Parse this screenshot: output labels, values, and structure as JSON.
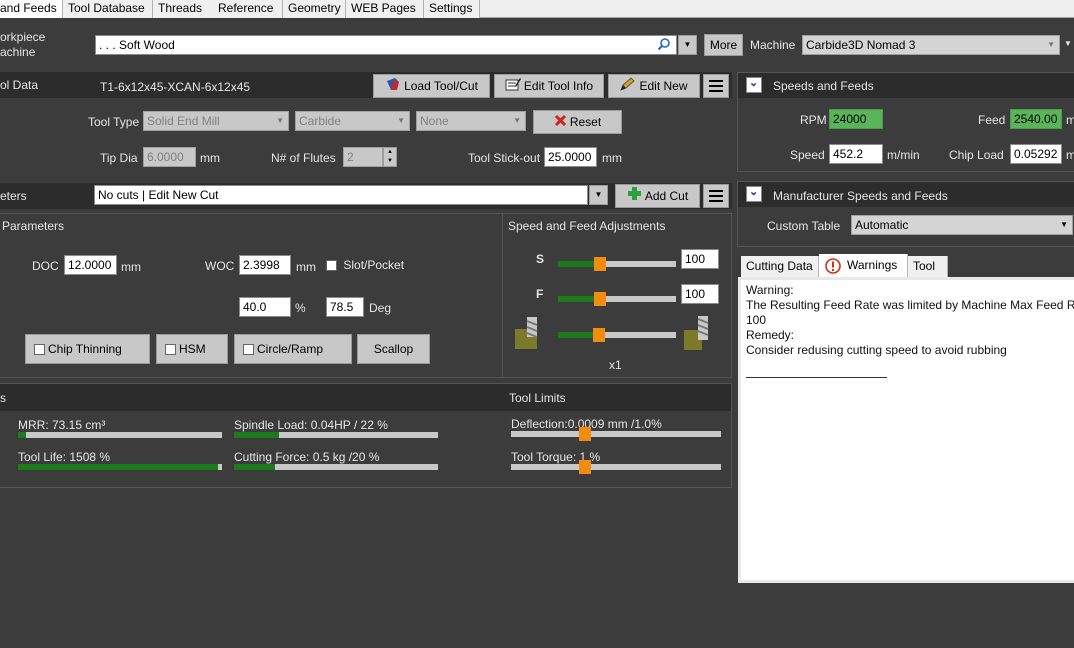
{
  "tabs": [
    "and Feeds",
    "Tool Database",
    "Threads",
    "Reference",
    "Geometry",
    "WEB Pages",
    "Settings"
  ],
  "workpiece": {
    "label1": "orkpiece",
    "label2": "achine",
    "material": ". . . Soft Wood",
    "more_label": "More",
    "machine_label": "Machine",
    "machine_value": "Carbide3D Nomad 3"
  },
  "tool": {
    "header": "ol Data",
    "name": "T1-6x12x45-XCAN-6x12x45",
    "load_label": "Load Tool/Cut",
    "edit_info_label": "Edit Tool Info",
    "edit_new_label": "Edit New",
    "tool_type_label": "Tool Type",
    "tool_type": "Solid End Mill",
    "material": "Carbide",
    "coating": "None",
    "reset_label": "Reset",
    "tip_dia_label": "Tip Dia",
    "tip_dia": "6.0000",
    "tip_dia_unit": "mm",
    "flutes_label": "N# of Flutes",
    "flutes": "2",
    "stickout_label": "Tool Stick-out",
    "stickout": "25.0000",
    "stickout_unit": "mm"
  },
  "cut": {
    "header": "eters",
    "selector": "No cuts | Edit New Cut",
    "add_label": "Add Cut"
  },
  "params": {
    "title": "Parameters",
    "doc_label": "DOC",
    "doc": "12.0000",
    "doc_unit": "mm",
    "woc_label": "WOC",
    "woc": "2.3998",
    "woc_unit": "mm",
    "slot_label": "Slot/Pocket",
    "percent": "40.0",
    "percent_unit": "%",
    "angle": "78.5",
    "angle_unit": "Deg",
    "chip_thinning": "Chip Thinning",
    "hsm": "HSM",
    "circle_ramp": "Circle/Ramp",
    "scallop": "Scallop"
  },
  "adjust": {
    "title": "Speed and Feed Adjustments",
    "s_label": "S",
    "s_value": "100",
    "s_level": 0.36,
    "f_label": "F",
    "f_value": "100",
    "f_level": 0.36,
    "tool_level": 0.35,
    "multiplier": "x1"
  },
  "results": {
    "header": "s",
    "limits_header": "Tool Limits",
    "mrr": "MRR: 73.15 cm³",
    "mrr_level": 0.04,
    "spindle": "Spindle Load: 0.04HP / 22 %",
    "spindle_level": 0.22,
    "tool_life": "Tool Life: 1508 %",
    "tool_life_level": 0.98,
    "cutting_force": "Cutting Force: 0.5 kg /20 %",
    "cutting_force_level": 0.2,
    "deflection": "Deflection:0.0009 mm /1.0%",
    "deflection_level": 0.35,
    "torque": "Tool Torque: 1 %",
    "torque_level": 0.35
  },
  "speeds": {
    "header": "Speeds and Feeds",
    "rpm_label": "RPM",
    "rpm": "24000",
    "feed_label": "Feed",
    "feed": "2540.00",
    "speed_label": "Speed",
    "speed": "452.2",
    "speed_unit": "m/min",
    "chipload_label": "Chip Load",
    "chipload": "0.05292",
    "chipload_unit": "m"
  },
  "manufacturer": {
    "header": "Manufacturer Speeds and Feeds",
    "custom_table_label": "Custom Table",
    "custom_table": "Automatic"
  },
  "info": {
    "tabs": [
      "Cutting Data",
      "Warnings",
      "Tool"
    ],
    "lines": [
      "Warning:",
      "The Resulting Feed Rate was limited by Machine Max Feed R",
      "100",
      "Remedy:",
      "Consider redusing cutting speed to avoid rubbing"
    ]
  },
  "colors": {
    "accent_green": "#1c7a1c",
    "thumb_orange": "#f28c0f",
    "bg_dark": "#3c3c3c",
    "header_dark": "#2c2c2c"
  }
}
